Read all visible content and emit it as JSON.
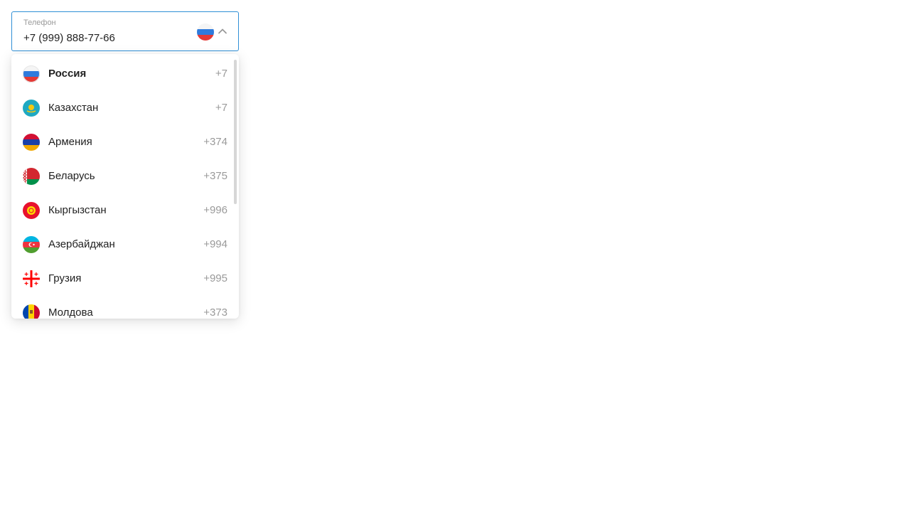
{
  "phone": {
    "label": "Телефон",
    "value": "+7 (999) 888-77-66",
    "selected_flag_icon": "flag-russia-icon",
    "chevron_icon": "chevron-up-icon",
    "accent_color": "#2f8fd6"
  },
  "countries": [
    {
      "name": "Россия",
      "code": "+7",
      "flag_icon": "flag-russia-icon",
      "selected": true
    },
    {
      "name": "Казахстан",
      "code": "+7",
      "flag_icon": "flag-kazakhstan-icon"
    },
    {
      "name": "Армения",
      "code": "+374",
      "flag_icon": "flag-armenia-icon"
    },
    {
      "name": "Беларусь",
      "code": "+375",
      "flag_icon": "flag-belarus-icon"
    },
    {
      "name": "Кыргызстан",
      "code": "+996",
      "flag_icon": "flag-kyrgyzstan-icon"
    },
    {
      "name": "Азербайджан",
      "code": "+994",
      "flag_icon": "flag-azerbaijan-icon"
    },
    {
      "name": "Грузия",
      "code": "+995",
      "flag_icon": "flag-georgia-icon"
    },
    {
      "name": "Молдова",
      "code": "+373",
      "flag_icon": "flag-moldova-icon"
    }
  ]
}
